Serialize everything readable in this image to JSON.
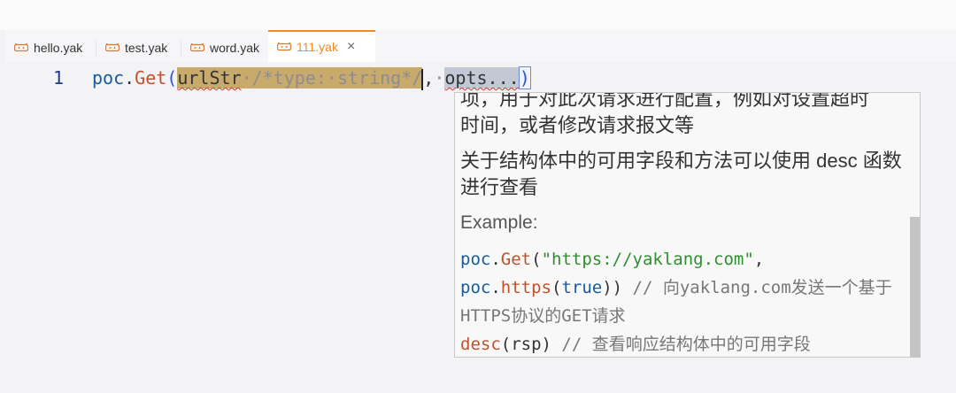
{
  "tabs": [
    {
      "label": "hello.yak",
      "active": false
    },
    {
      "label": "test.yak",
      "active": false
    },
    {
      "label": "word.yak",
      "active": false
    },
    {
      "label": "111.yak",
      "active": true
    }
  ],
  "tab_close_glyph": "×",
  "editor": {
    "line_number": "1",
    "code": {
      "obj": "poc",
      "dot": ".",
      "fn": "Get",
      "open": "(",
      "param1": "urlStr",
      "param1_hint": "·/*type:·string*/",
      "comma": ",",
      "space": "·",
      "param2": "opts...",
      "close": ")"
    }
  },
  "hover": {
    "para1_line1": "项，用于对此次请求进行配置，例如对设置超时",
    "para1_line2": "时间，或者修改请求报文等",
    "para2": "关于结构体中的可用字段和方法可以使用 desc 函数进行查看",
    "example_label": "Example:",
    "line1": {
      "obj": "poc",
      "fn": "Get",
      "str": "\"https://yaklang.com\"",
      "rest": ","
    },
    "line2": {
      "obj": "poc",
      "fn": "https",
      "kw": "true",
      "rest": "))",
      "comment": " // 向yaklang.com发送一个基于HTTPS协议的GET请求"
    },
    "line3": {
      "fn": "desc",
      "arg": "(rsp)",
      "comment": " // 查看响应结构体中的可用字段"
    }
  },
  "colors": {
    "accent": "#f08a24",
    "highlight": "#c9aa6d"
  }
}
